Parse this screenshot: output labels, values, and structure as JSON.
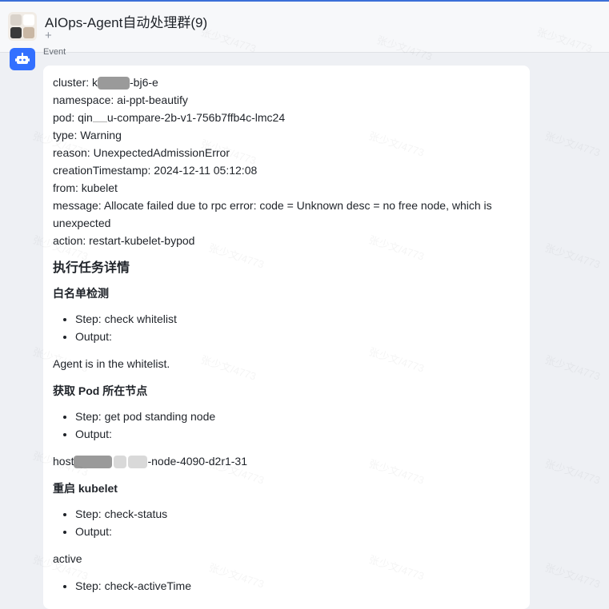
{
  "header": {
    "title": "AIOps-Agent自动处理群(9)",
    "add_tab": "+"
  },
  "bot": {
    "sender_label": "Event"
  },
  "message": {
    "cluster_label": "cluster: ",
    "cluster_prefix": "k",
    "cluster_suffix": "-bj6-e",
    "namespace": "namespace: ai-ppt-beautify",
    "pod_prefix": "pod: qin",
    "pod_suffix": "u-compare-2b-v1-756b7ffb4c-lmc24",
    "type": "type: Warning",
    "reason": "reason: UnexpectedAdmissionError",
    "creation": "creationTimestamp: 2024-12-11 05:12:08",
    "from": "from: kubelet",
    "msg": "message: Allocate failed due to rpc error: code = Unknown desc = no free node, which is unexpected",
    "action": "action: restart-kubelet-bypod"
  },
  "details": {
    "heading": "执行任务详情",
    "sections": [
      {
        "title": "白名单检测",
        "items": [
          "Step: check whitelist",
          "Output:"
        ],
        "result": "Agent is in the whitelist."
      },
      {
        "title": "获取 Pod 所在节点",
        "items": [
          "Step: get pod standing node",
          "Output:"
        ],
        "result_prefix": "host",
        "result_suffix": "-node-4090-d2r1-31"
      },
      {
        "title": "重启 kubelet",
        "items": [
          "Step: check-status",
          "Output:"
        ],
        "result": "active",
        "extra_items": [
          "Step: check-activeTime"
        ]
      }
    ]
  },
  "watermark_text": "张少文/4773",
  "colors": {
    "accent": "#3370ff",
    "background": "#eef0f4",
    "card": "#ffffff",
    "text": "#1f2329"
  }
}
